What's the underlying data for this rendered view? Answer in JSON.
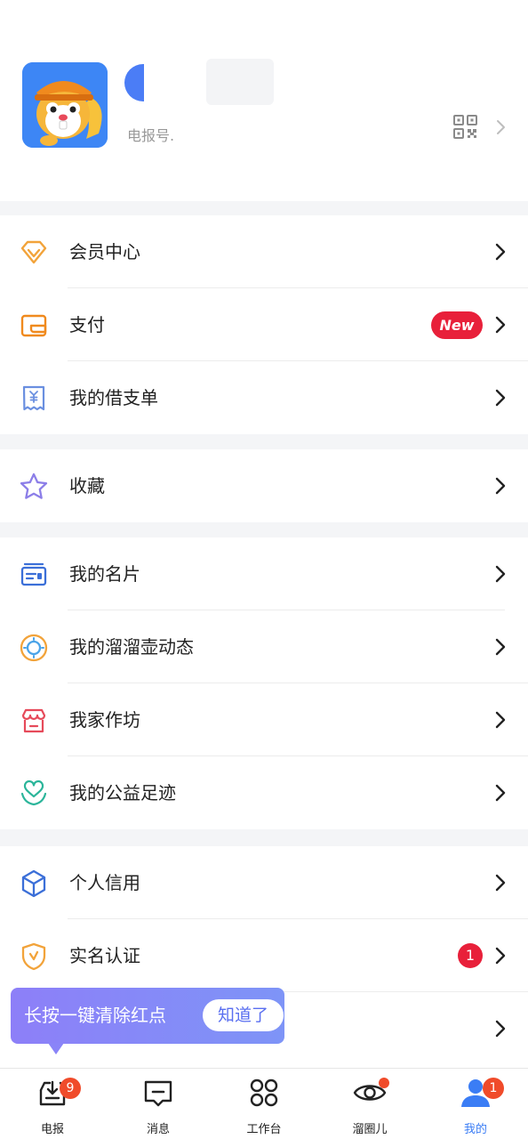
{
  "profile": {
    "account_label": "电报号.",
    "avatar": "squirrel-mascot-avatar",
    "qr_icon": "qr-code-icon"
  },
  "menu_groups": [
    {
      "items": [
        {
          "label": "会员中心",
          "icon": "diamond-icon"
        },
        {
          "label": "支付",
          "icon": "wallet-icon",
          "badge": "New"
        },
        {
          "label": "我的借支单",
          "icon": "receipt-icon"
        }
      ]
    },
    {
      "items": [
        {
          "label": "收藏",
          "icon": "star-icon"
        }
      ]
    },
    {
      "items": [
        {
          "label": "我的名片",
          "icon": "business-card-icon"
        },
        {
          "label": "我的溜溜壶动态",
          "icon": "sun-circle-icon"
        },
        {
          "label": "我家作坊",
          "icon": "shop-icon"
        },
        {
          "label": "我的公益足迹",
          "icon": "heart-hands-icon"
        }
      ]
    },
    {
      "items": [
        {
          "label": "个人信用",
          "icon": "cube-icon"
        },
        {
          "label": "实名认证",
          "icon": "shield-check-icon",
          "badge": "1"
        },
        {
          "label": "",
          "icon": ""
        }
      ]
    }
  ],
  "tooltip": {
    "text": "长按一键清除红点",
    "button": "知道了"
  },
  "tabbar": {
    "tabs": [
      {
        "label": "电报",
        "icon": "inbox-download-icon",
        "badge": "9"
      },
      {
        "label": "消息",
        "icon": "message-icon"
      },
      {
        "label": "工作台",
        "icon": "workbench-icon"
      },
      {
        "label": "溜圈儿",
        "icon": "eye-icon",
        "dot": true
      },
      {
        "label": "我的",
        "icon": "user-icon",
        "badge": "1",
        "active": true
      }
    ]
  },
  "colors": {
    "accent": "#3b7df5",
    "badge_red": "#e8203a",
    "tooltip_from": "#8d7ff8",
    "tooltip_to": "#7e94f7"
  }
}
